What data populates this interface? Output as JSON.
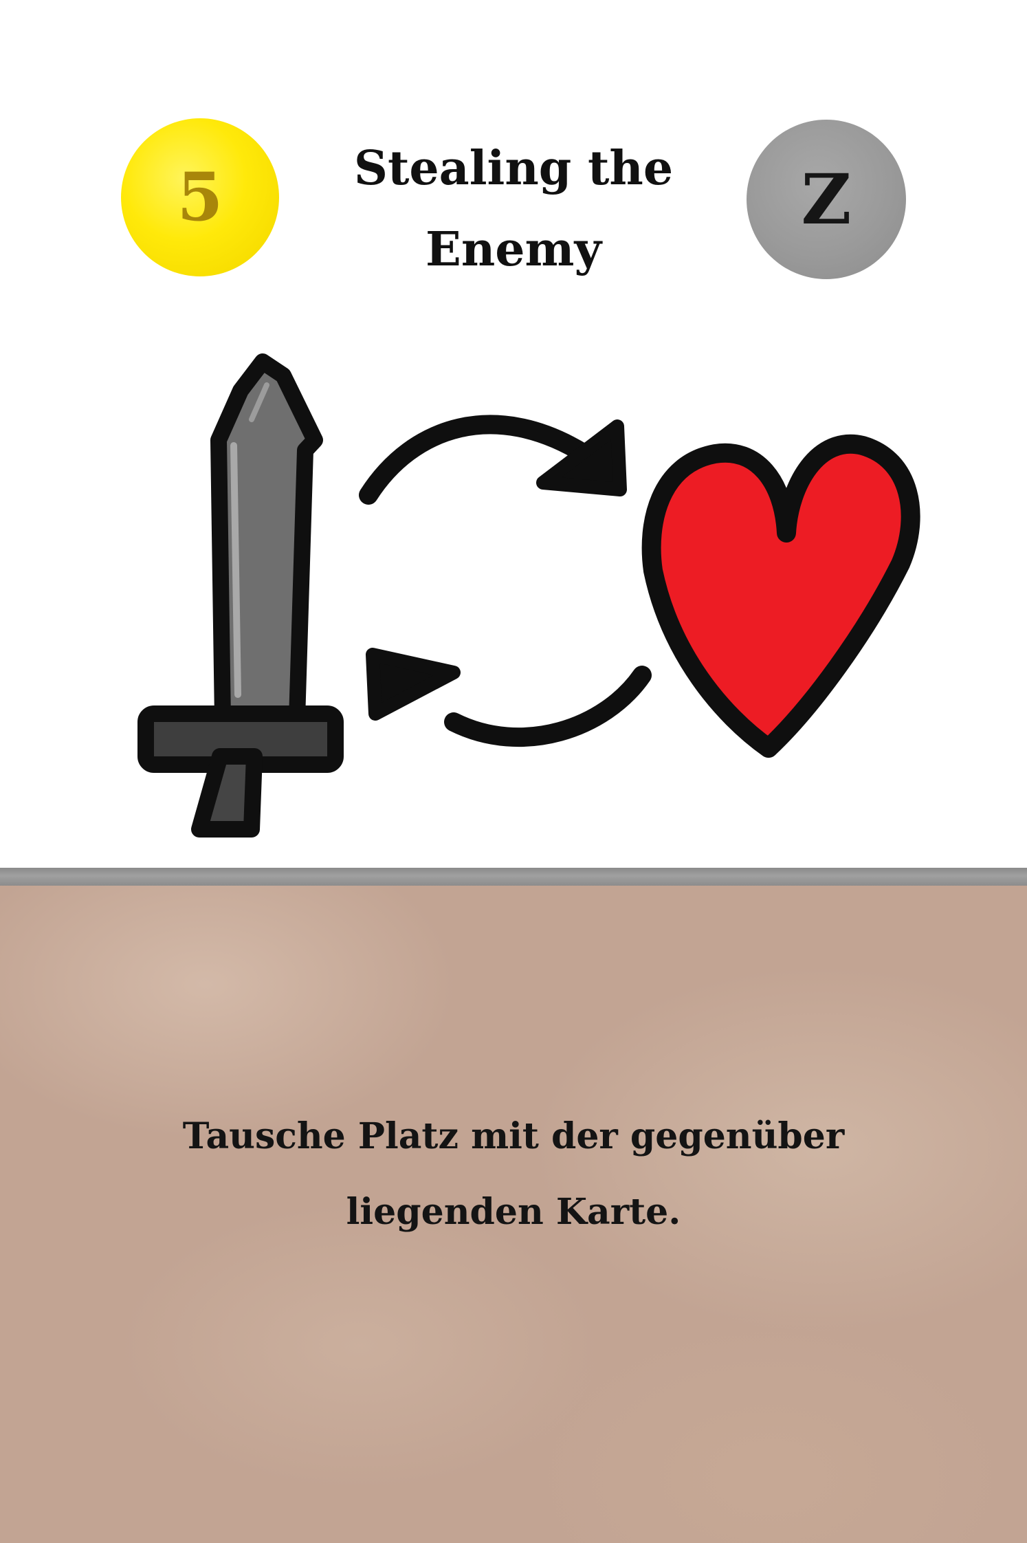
{
  "card": {
    "title": "Stealing the Enemy",
    "cost": "5",
    "type_letter": "Z",
    "description": "Tausche Platz mit der gegenüber liegenden Karte.",
    "illustration": {
      "icons": [
        "sword-icon",
        "swap-arrows-icon",
        "heart-icon"
      ]
    }
  },
  "colors": {
    "cost_coin": "#ffe90a",
    "cost_text": "#a8860a",
    "type_coin": "#9a9a9a",
    "heart": "#ed1c24",
    "sword": "#6f6f6f",
    "text_panel": "#c2a493",
    "divider": "#9a9a9a"
  }
}
